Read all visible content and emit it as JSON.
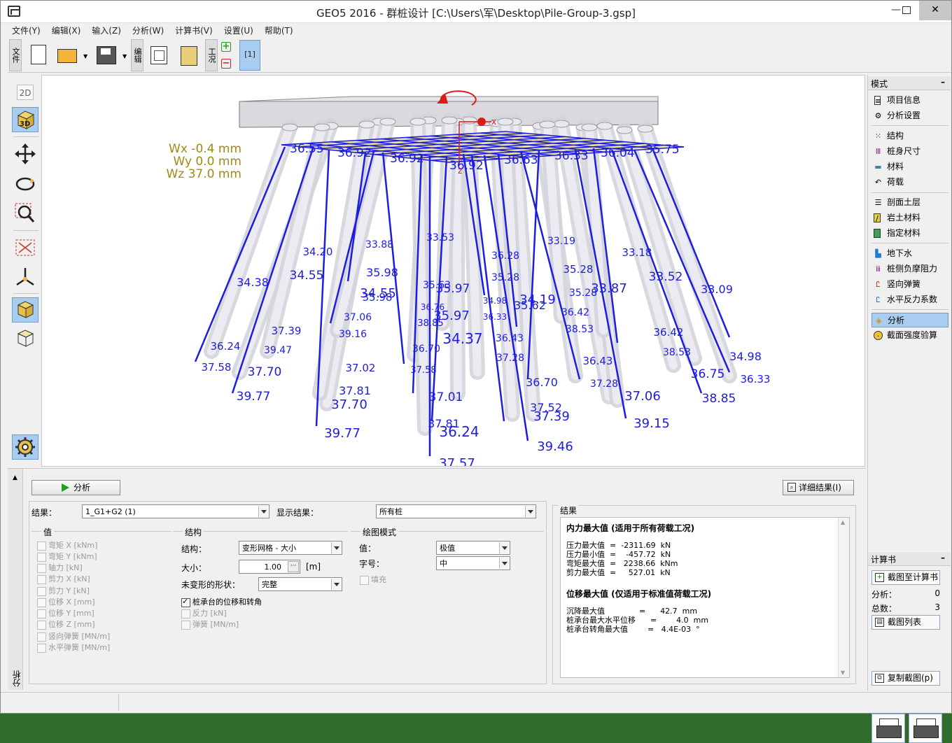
{
  "window": {
    "title": "GEO5 2016 - 群桩设计 [C:\\Users\\军\\Desktop\\Pile-Group-3.gsp]",
    "minimize": "—",
    "close": "✕"
  },
  "menu": [
    "文件(Y)",
    "编辑(X)",
    "输入(Z)",
    "分析(W)",
    "计算书(V)",
    "设置(U)",
    "帮助(T)"
  ],
  "toolbar": {
    "file_group": "文件",
    "edit_group": "编辑",
    "stage_group": "工况",
    "tab_label": "[1]"
  },
  "view": {
    "btn_2d": "2D",
    "btn_3d": "3D",
    "disp": [
      "Wx -0.4 mm",
      "Wy 0.0 mm",
      "Wz 37.0 mm"
    ],
    "axis_x": "x",
    "axis_z": "z",
    "top_labels": [
      "36.55",
      "36.92",
      "36.92",
      "36.92",
      "36.63",
      "36.33",
      "36.04",
      "35.75"
    ],
    "labels": [
      [
        "34.20",
        452,
        357,
        15
      ],
      [
        "33.88",
        540,
        346,
        14
      ],
      [
        "33.53",
        627,
        336,
        14
      ],
      [
        "33.19",
        800,
        341,
        14
      ],
      [
        "33.18",
        908,
        358,
        15
      ],
      [
        "34.38",
        359,
        401,
        16
      ],
      [
        "34.55",
        436,
        391,
        17
      ],
      [
        "35.98",
        544,
        387,
        16
      ],
      [
        "36.28",
        720,
        362,
        14
      ],
      [
        "35.28",
        824,
        382,
        15
      ],
      [
        "33.52",
        949,
        393,
        17
      ],
      [
        "33.09",
        1022,
        411,
        16
      ],
      [
        "34.55",
        538,
        417,
        18
      ],
      [
        "35.98",
        537,
        422,
        15
      ],
      [
        "35.63",
        622,
        404,
        14
      ],
      [
        "35.97",
        645,
        410,
        17
      ],
      [
        "35.28",
        720,
        393,
        14
      ],
      [
        "35.28",
        831,
        415,
        14
      ],
      [
        "33.87",
        868,
        410,
        18
      ],
      [
        "34.19",
        766,
        426,
        18
      ],
      [
        "35.62",
        755,
        434,
        16
      ],
      [
        "34.98",
        705,
        426,
        12
      ],
      [
        "36.76",
        616,
        435,
        12
      ],
      [
        "36.42",
        820,
        443,
        14
      ],
      [
        "37.06",
        509,
        450,
        14
      ],
      [
        "35.97",
        643,
        449,
        18
      ],
      [
        "36.33",
        705,
        449,
        12
      ],
      [
        "38.85",
        613,
        458,
        13
      ],
      [
        "38.53",
        826,
        467,
        14
      ],
      [
        "36.42",
        953,
        472,
        15
      ],
      [
        "37.39",
        407,
        470,
        15
      ],
      [
        "39.16",
        502,
        474,
        14
      ],
      [
        "34.37",
        659,
        483,
        20
      ],
      [
        "36.43",
        726,
        480,
        14
      ],
      [
        "36.24",
        320,
        492,
        15
      ],
      [
        "39.47",
        395,
        497,
        14
      ],
      [
        "36.70",
        607,
        495,
        14
      ],
      [
        "38.53",
        965,
        500,
        14
      ],
      [
        "34.98",
        1063,
        507,
        16
      ],
      [
        "37.58",
        307,
        522,
        15
      ],
      [
        "37.02",
        513,
        523,
        15
      ],
      [
        "37.58",
        603,
        525,
        13
      ],
      [
        "37.28",
        727,
        508,
        14
      ],
      [
        "36.43",
        852,
        513,
        15
      ],
      [
        "37.70",
        376,
        529,
        17
      ],
      [
        "36.75",
        1009,
        532,
        17
      ],
      [
        "36.33",
        1077,
        539,
        15
      ],
      [
        "37.28",
        861,
        545,
        14
      ],
      [
        "36.70",
        772,
        544,
        16
      ],
      [
        "37.81",
        505,
        556,
        16
      ],
      [
        "39.77",
        360,
        564,
        17
      ],
      [
        "37.01",
        635,
        565,
        17
      ],
      [
        "37.06",
        916,
        564,
        18
      ],
      [
        "38.85",
        1025,
        567,
        17
      ],
      [
        "37.70",
        497,
        576,
        18
      ],
      [
        "37.52",
        778,
        580,
        16
      ],
      [
        "37.39",
        786,
        593,
        18
      ],
      [
        "39.15",
        929,
        603,
        18
      ],
      [
        "37.81",
        632,
        603,
        16
      ],
      [
        "39.77",
        487,
        617,
        18
      ],
      [
        "36.24",
        654,
        616,
        20
      ],
      [
        "39.46",
        791,
        636,
        18
      ],
      [
        "37.57",
        651,
        660,
        18
      ]
    ]
  },
  "mode_panel": {
    "title": "模式",
    "items": [
      "项目信息",
      "分析设置",
      "结构",
      "桩身尺寸",
      "材料",
      "荷载",
      "剖面土层",
      "岩土材料",
      "指定材料",
      "地下水",
      "桩侧负摩阻力",
      "竖向弹簧",
      "水平反力系数",
      "分析",
      "截面强度验算"
    ]
  },
  "report_panel": {
    "title": "计算书",
    "add_btn": "截图至计算书",
    "analysis_label": "分析：",
    "analysis_count": "0",
    "total_label": "总数：",
    "total_count": "3",
    "list_btn": "截图列表",
    "copy_btn": "复制截图(p)"
  },
  "bottom": {
    "tab_label": "分析",
    "analyze_btn": "分析",
    "detail_btn": "详细结果(I)",
    "result_label": "结果：",
    "result_value": "1_G1+G2 (1)",
    "display_label": "显示结果：",
    "display_value": "所有桩",
    "values_group": "值",
    "values": [
      "弯矩 X [kNm]",
      "弯矩 Y [kNm]",
      "轴力 [kN]",
      "剪力 X [kN]",
      "剪力 Y [kN]",
      "位移 X [mm]",
      "位移 Y [mm]",
      "位移 Z [mm]",
      "竖向弹簧 [MN/m]",
      "水平弹簧 [MN/m]"
    ],
    "struct_group": "结构",
    "struct_label": "结构：",
    "struct_value": "变形网格 - 大小",
    "size_label": "大小：",
    "size_value": "1.00",
    "size_unit": "[m]",
    "shape_label": "未变形的形状：",
    "shape_value": "完整",
    "chk_cap": "桩承台的位移和转角",
    "chk_reaction": "反力 [kN]",
    "chk_spring": "弹簧 [MN/m]",
    "draw_group": "绘图模式",
    "draw_value_label": "值：",
    "draw_value": "极值",
    "font_label": "字号：",
    "font_value": "中",
    "fill_label": "填充",
    "results_title": "结果",
    "res_h1": "内力最大值 (适用于所有荷载工况)",
    "res_rows1": [
      "压力最大值  =  -2311.69  kN",
      "压力最小值  =    -457.72  kN",
      "弯矩最大值  =   2238.66  kNm",
      "剪力最大值  =     527.01  kN"
    ],
    "res_h2": "位移最大值 (仅适用于标准值荷载工况)",
    "res_rows2": [
      "沉降最大值              =      42.7  mm",
      "桩承台最大水平位移      =        4.0  mm",
      "桩承台转角最大值        =   4.4E-03  °"
    ]
  }
}
